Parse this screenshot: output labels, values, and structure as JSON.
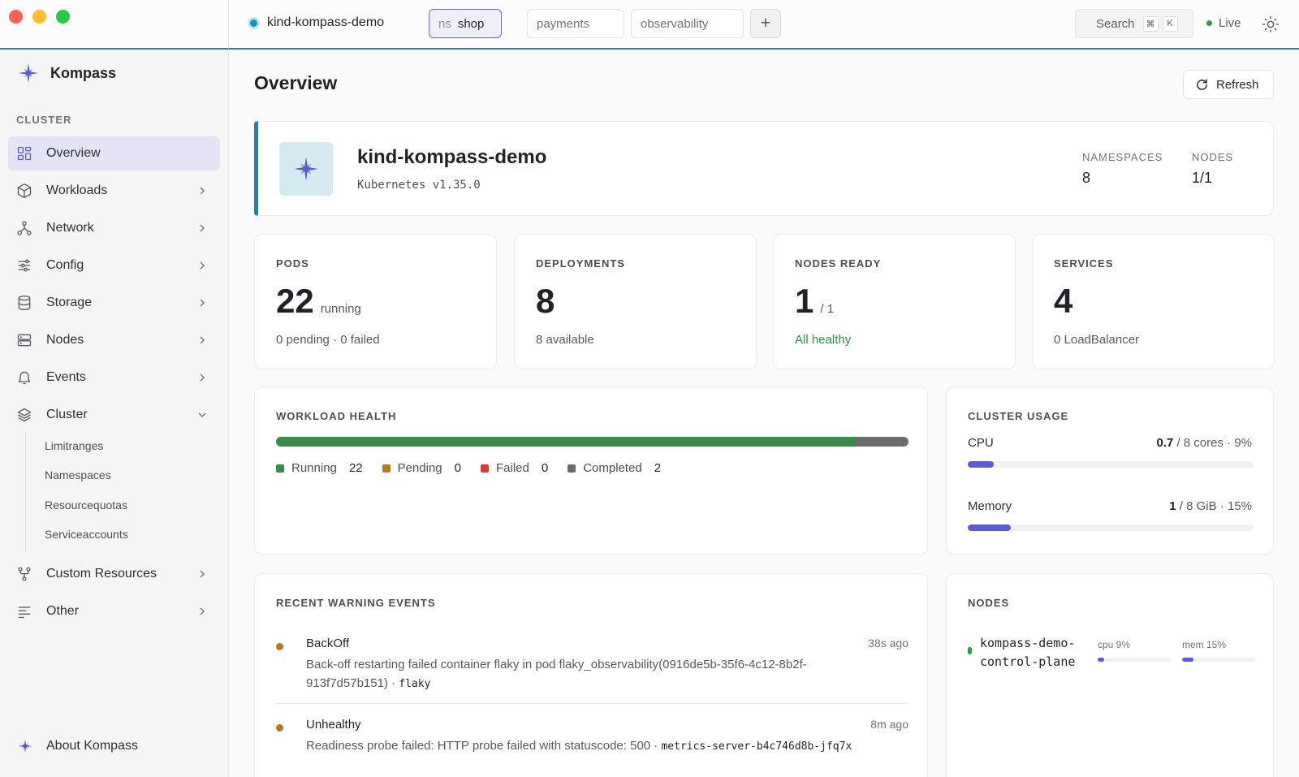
{
  "window": {
    "context": "kind-kompass-demo",
    "namespaces": {
      "active_prefix": "ns",
      "active": "shop",
      "others": [
        "payments",
        "observability"
      ],
      "add_label": "+"
    },
    "search_label": "Search",
    "search_keys": [
      "⌘",
      "K"
    ],
    "live_label": "Live"
  },
  "sidebar": {
    "brand": "Kompass",
    "section": "CLUSTER",
    "items": [
      {
        "label": "Overview",
        "icon": "grid-icon"
      },
      {
        "label": "Workloads",
        "icon": "cube-icon"
      },
      {
        "label": "Network",
        "icon": "network-icon"
      },
      {
        "label": "Config",
        "icon": "sliders-icon"
      },
      {
        "label": "Storage",
        "icon": "database-icon"
      },
      {
        "label": "Nodes",
        "icon": "server-icon"
      },
      {
        "label": "Events",
        "icon": "bell-icon"
      },
      {
        "label": "Cluster",
        "icon": "layers-icon"
      },
      {
        "label": "Custom Resources",
        "icon": "git-fork-icon"
      },
      {
        "label": "Other",
        "icon": "list-icon"
      }
    ],
    "cluster_sub": [
      "Limitranges",
      "Namespaces",
      "Resourcequotas",
      "Serviceaccounts"
    ],
    "about": "About Kompass"
  },
  "main": {
    "title": "Overview",
    "refresh_label": "Refresh",
    "cluster": {
      "name": "kind-kompass-demo",
      "version": "Kubernetes v1.35.0",
      "namespaces_label": "NAMESPACES",
      "namespaces_value": "8",
      "nodes_label": "NODES",
      "nodes_value": "1/1"
    },
    "stats": [
      {
        "label": "PODS",
        "value": "22",
        "unit": "running",
        "sub": "0 pending · 0 failed",
        "sub_status": "neutral"
      },
      {
        "label": "DEPLOYMENTS",
        "value": "8",
        "unit": "",
        "sub": "8 available",
        "sub_status": "neutral"
      },
      {
        "label": "NODES READY",
        "value": "1",
        "unit": "/ 1",
        "sub": "All healthy",
        "sub_status": "ok"
      },
      {
        "label": "SERVICES",
        "value": "4",
        "unit": "",
        "sub": "0 LoadBalancer",
        "sub_status": "neutral"
      }
    ],
    "workload_health": {
      "label": "WORKLOAD HEALTH",
      "segments": [
        {
          "label": "Running",
          "count": 22,
          "color": "#3a8a4a"
        },
        {
          "label": "Pending",
          "count": 0,
          "color": "#b07b1e"
        },
        {
          "label": "Failed",
          "count": 0,
          "color": "#d63a3a"
        },
        {
          "label": "Completed",
          "count": 2,
          "color": "#6b6b70"
        }
      ]
    },
    "usage": {
      "label": "CLUSTER USAGE",
      "cpu": {
        "label": "CPU",
        "used": "0.7",
        "rest": " / 8 cores · 9%",
        "percent": 9
      },
      "memory": {
        "label": "Memory",
        "used": "1",
        "rest": " / 8 GiB · 15%",
        "percent": 15
      }
    },
    "events": {
      "label": "RECENT WARNING EVENTS",
      "items": [
        {
          "reason": "BackOff",
          "time": "38s ago",
          "message": "Back-off restarting failed container flaky in pod flaky_observability(0916de5b-35f6-4c12-8b2f-913f7d57b151) · ",
          "object": "flaky"
        },
        {
          "reason": "Unhealthy",
          "time": "8m ago",
          "message": "Readiness probe failed: HTTP probe failed with statuscode: 500 · ",
          "object": "metrics-server-b4c746d8b-jfq7x"
        }
      ]
    },
    "nodes": {
      "label": "NODES",
      "items": [
        {
          "name": "kompass-demo-control-plane",
          "cpu_label": "cpu 9%",
          "cpu_percent": 9,
          "mem_label": "mem 15%",
          "mem_percent": 15
        }
      ]
    }
  },
  "colors": {
    "accent": "#5b5bd6",
    "cluster_accent": "#1a84b0",
    "ok": "#3a8a4a",
    "warning": "#b07b1e"
  }
}
